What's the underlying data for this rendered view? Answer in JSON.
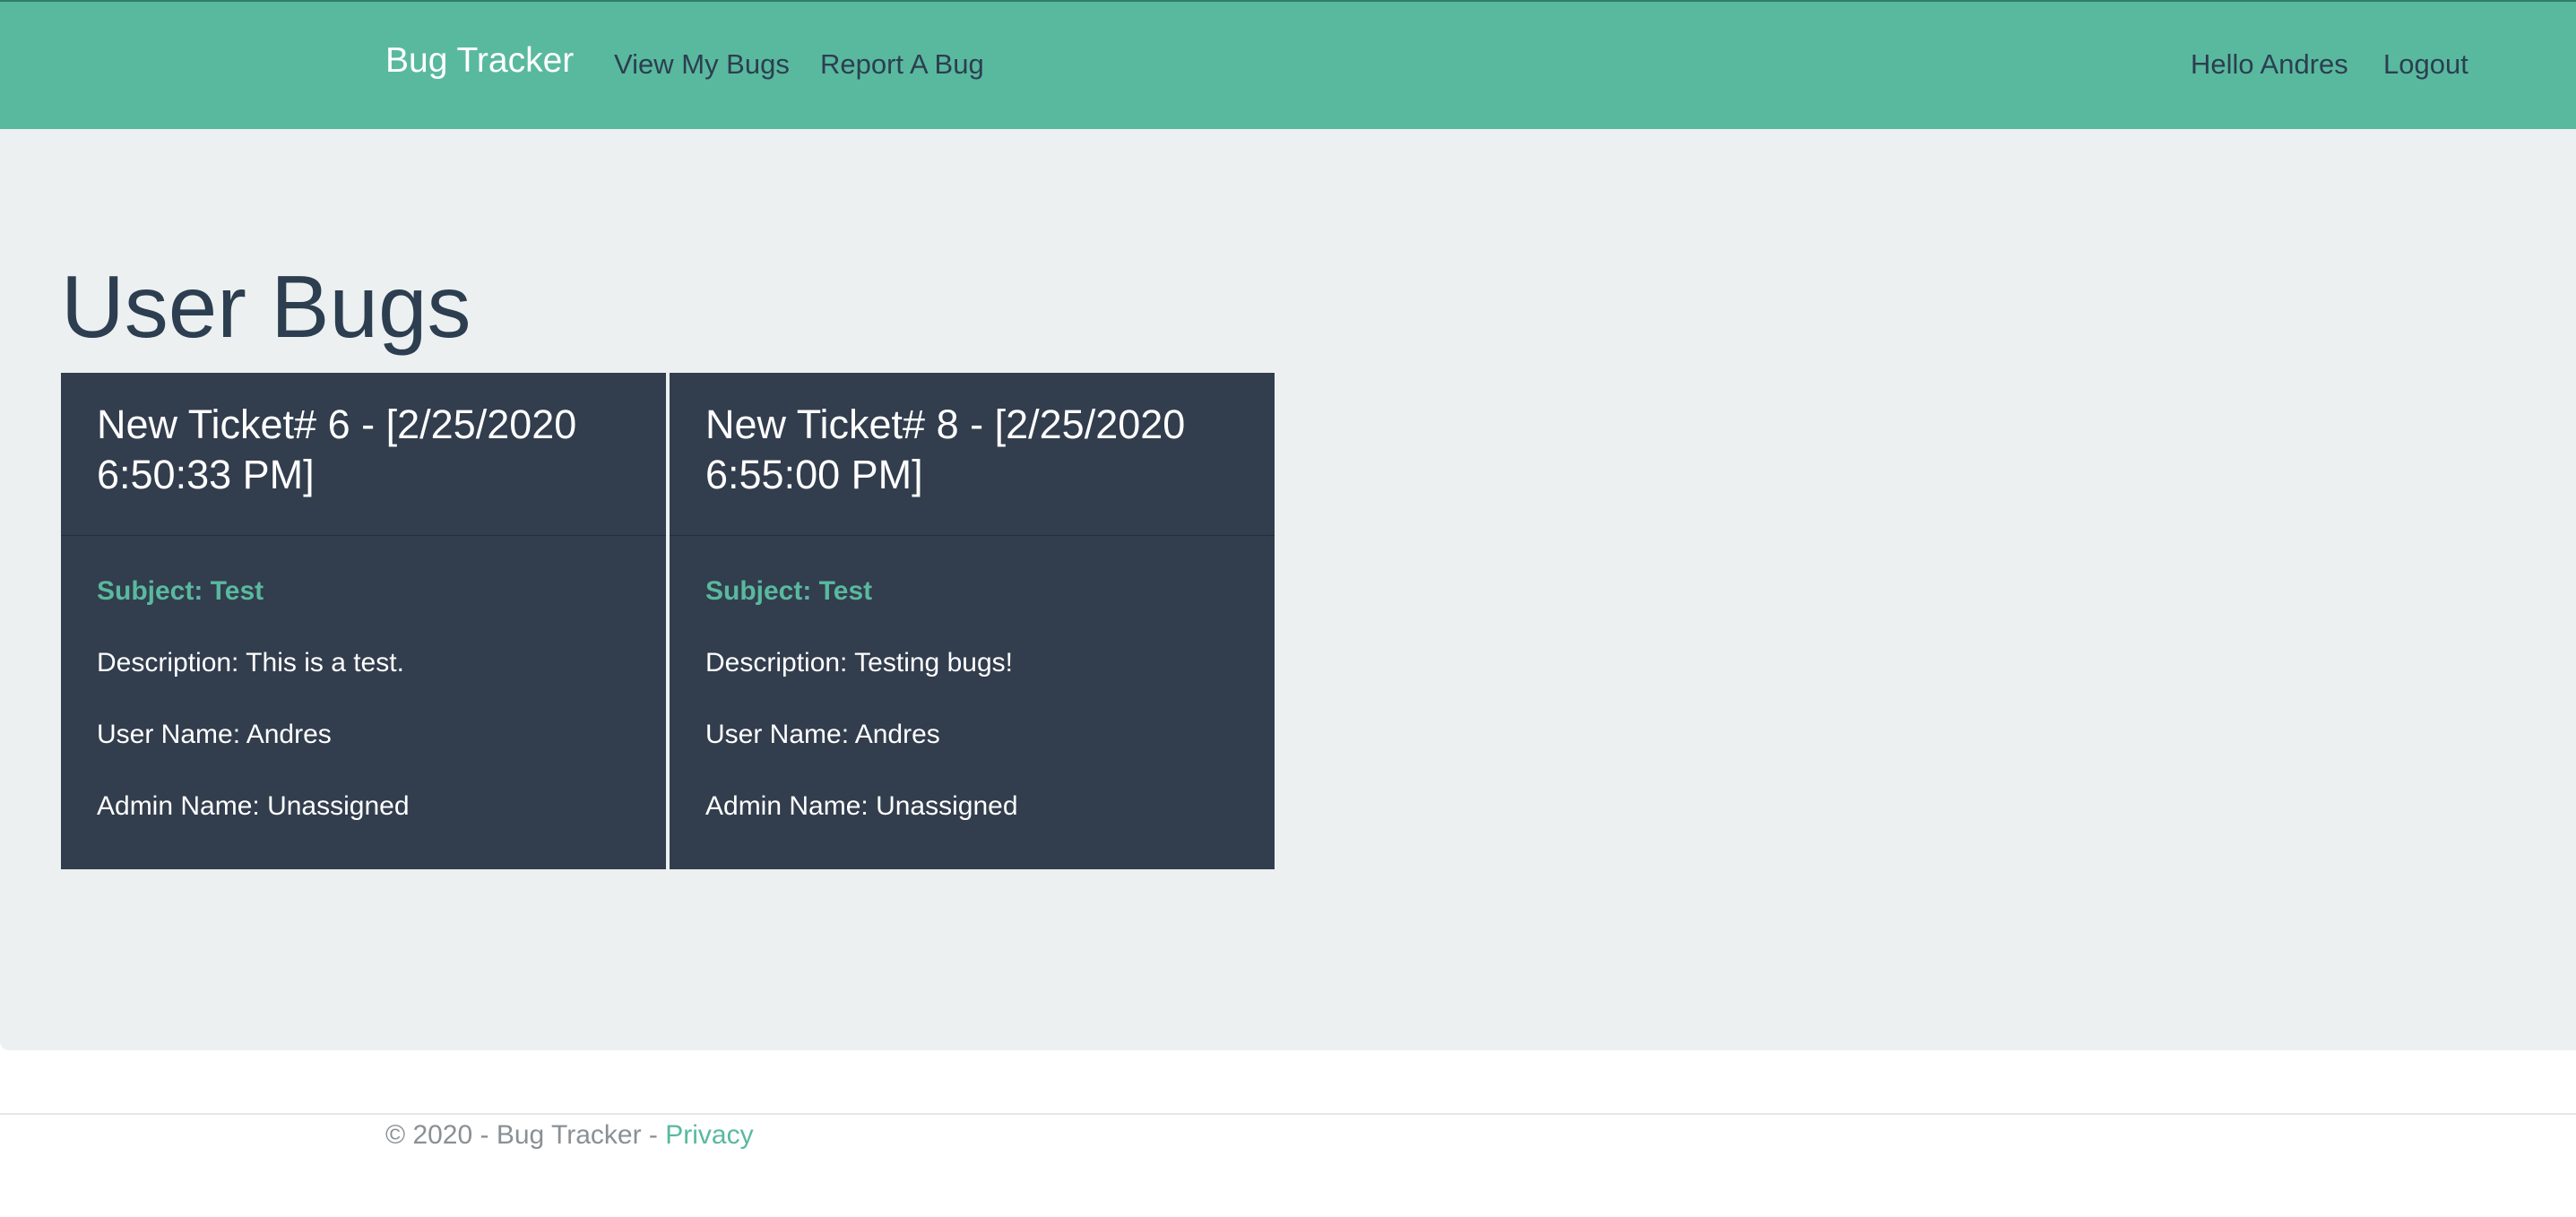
{
  "navbar": {
    "brand": "Bug Tracker",
    "links": {
      "view_bugs": "View My Bugs",
      "report_bug": "Report A Bug",
      "greeting": "Hello Andres",
      "logout": "Logout"
    },
    "bg_color": "#59b99e"
  },
  "main": {
    "title": "User Bugs",
    "tickets": [
      {
        "title": "New Ticket# 6 - [2/25/2020 6:50:33 PM]",
        "subject": "Subject: Test",
        "description": "Description: This is a test.",
        "user_name": "User Name: Andres",
        "admin_name": "Admin Name: Unassigned"
      },
      {
        "title": "New Ticket# 8 - [2/25/2020 6:55:00 PM]",
        "subject": "Subject: Test",
        "description": "Description: Testing bugs!",
        "user_name": "User Name: Andres",
        "admin_name": "Admin Name: Unassigned"
      }
    ]
  },
  "footer": {
    "copyright": "© 2020 - Bug Tracker - ",
    "privacy_link": "Privacy"
  },
  "colors": {
    "accent": "#59b99e",
    "card_bg": "#323d4d",
    "jumbotron_bg": "#ecf0f1",
    "text_dark": "#2c3e50"
  }
}
